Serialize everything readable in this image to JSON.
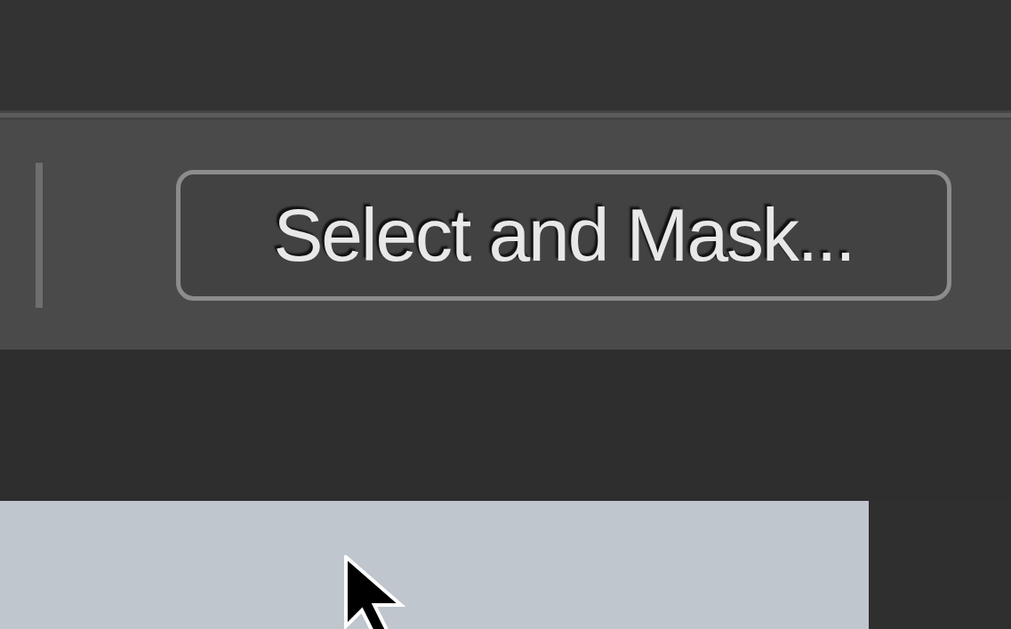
{
  "options_bar": {
    "button": {
      "label": "Select and Mask..."
    }
  }
}
